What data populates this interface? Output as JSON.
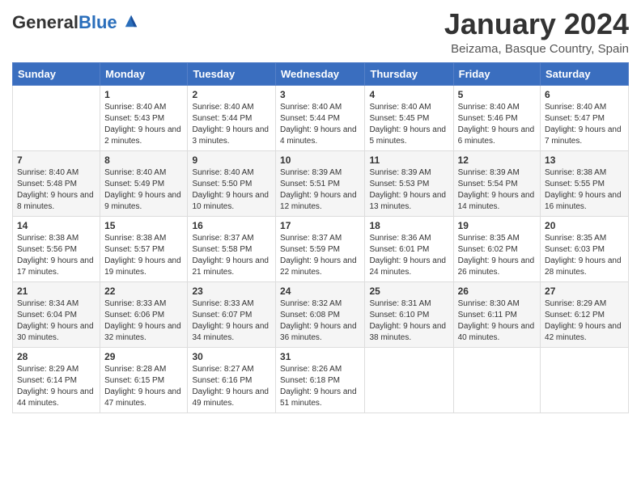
{
  "header": {
    "logo_general": "General",
    "logo_blue": "Blue",
    "month": "January 2024",
    "location": "Beizama, Basque Country, Spain"
  },
  "weekdays": [
    "Sunday",
    "Monday",
    "Tuesday",
    "Wednesday",
    "Thursday",
    "Friday",
    "Saturday"
  ],
  "weeks": [
    [
      {
        "num": "",
        "sunrise": "",
        "sunset": "",
        "daylight": ""
      },
      {
        "num": "1",
        "sunrise": "Sunrise: 8:40 AM",
        "sunset": "Sunset: 5:43 PM",
        "daylight": "Daylight: 9 hours and 2 minutes."
      },
      {
        "num": "2",
        "sunrise": "Sunrise: 8:40 AM",
        "sunset": "Sunset: 5:44 PM",
        "daylight": "Daylight: 9 hours and 3 minutes."
      },
      {
        "num": "3",
        "sunrise": "Sunrise: 8:40 AM",
        "sunset": "Sunset: 5:44 PM",
        "daylight": "Daylight: 9 hours and 4 minutes."
      },
      {
        "num": "4",
        "sunrise": "Sunrise: 8:40 AM",
        "sunset": "Sunset: 5:45 PM",
        "daylight": "Daylight: 9 hours and 5 minutes."
      },
      {
        "num": "5",
        "sunrise": "Sunrise: 8:40 AM",
        "sunset": "Sunset: 5:46 PM",
        "daylight": "Daylight: 9 hours and 6 minutes."
      },
      {
        "num": "6",
        "sunrise": "Sunrise: 8:40 AM",
        "sunset": "Sunset: 5:47 PM",
        "daylight": "Daylight: 9 hours and 7 minutes."
      }
    ],
    [
      {
        "num": "7",
        "sunrise": "Sunrise: 8:40 AM",
        "sunset": "Sunset: 5:48 PM",
        "daylight": "Daylight: 9 hours and 8 minutes."
      },
      {
        "num": "8",
        "sunrise": "Sunrise: 8:40 AM",
        "sunset": "Sunset: 5:49 PM",
        "daylight": "Daylight: 9 hours and 9 minutes."
      },
      {
        "num": "9",
        "sunrise": "Sunrise: 8:40 AM",
        "sunset": "Sunset: 5:50 PM",
        "daylight": "Daylight: 9 hours and 10 minutes."
      },
      {
        "num": "10",
        "sunrise": "Sunrise: 8:39 AM",
        "sunset": "Sunset: 5:51 PM",
        "daylight": "Daylight: 9 hours and 12 minutes."
      },
      {
        "num": "11",
        "sunrise": "Sunrise: 8:39 AM",
        "sunset": "Sunset: 5:53 PM",
        "daylight": "Daylight: 9 hours and 13 minutes."
      },
      {
        "num": "12",
        "sunrise": "Sunrise: 8:39 AM",
        "sunset": "Sunset: 5:54 PM",
        "daylight": "Daylight: 9 hours and 14 minutes."
      },
      {
        "num": "13",
        "sunrise": "Sunrise: 8:38 AM",
        "sunset": "Sunset: 5:55 PM",
        "daylight": "Daylight: 9 hours and 16 minutes."
      }
    ],
    [
      {
        "num": "14",
        "sunrise": "Sunrise: 8:38 AM",
        "sunset": "Sunset: 5:56 PM",
        "daylight": "Daylight: 9 hours and 17 minutes."
      },
      {
        "num": "15",
        "sunrise": "Sunrise: 8:38 AM",
        "sunset": "Sunset: 5:57 PM",
        "daylight": "Daylight: 9 hours and 19 minutes."
      },
      {
        "num": "16",
        "sunrise": "Sunrise: 8:37 AM",
        "sunset": "Sunset: 5:58 PM",
        "daylight": "Daylight: 9 hours and 21 minutes."
      },
      {
        "num": "17",
        "sunrise": "Sunrise: 8:37 AM",
        "sunset": "Sunset: 5:59 PM",
        "daylight": "Daylight: 9 hours and 22 minutes."
      },
      {
        "num": "18",
        "sunrise": "Sunrise: 8:36 AM",
        "sunset": "Sunset: 6:01 PM",
        "daylight": "Daylight: 9 hours and 24 minutes."
      },
      {
        "num": "19",
        "sunrise": "Sunrise: 8:35 AM",
        "sunset": "Sunset: 6:02 PM",
        "daylight": "Daylight: 9 hours and 26 minutes."
      },
      {
        "num": "20",
        "sunrise": "Sunrise: 8:35 AM",
        "sunset": "Sunset: 6:03 PM",
        "daylight": "Daylight: 9 hours and 28 minutes."
      }
    ],
    [
      {
        "num": "21",
        "sunrise": "Sunrise: 8:34 AM",
        "sunset": "Sunset: 6:04 PM",
        "daylight": "Daylight: 9 hours and 30 minutes."
      },
      {
        "num": "22",
        "sunrise": "Sunrise: 8:33 AM",
        "sunset": "Sunset: 6:06 PM",
        "daylight": "Daylight: 9 hours and 32 minutes."
      },
      {
        "num": "23",
        "sunrise": "Sunrise: 8:33 AM",
        "sunset": "Sunset: 6:07 PM",
        "daylight": "Daylight: 9 hours and 34 minutes."
      },
      {
        "num": "24",
        "sunrise": "Sunrise: 8:32 AM",
        "sunset": "Sunset: 6:08 PM",
        "daylight": "Daylight: 9 hours and 36 minutes."
      },
      {
        "num": "25",
        "sunrise": "Sunrise: 8:31 AM",
        "sunset": "Sunset: 6:10 PM",
        "daylight": "Daylight: 9 hours and 38 minutes."
      },
      {
        "num": "26",
        "sunrise": "Sunrise: 8:30 AM",
        "sunset": "Sunset: 6:11 PM",
        "daylight": "Daylight: 9 hours and 40 minutes."
      },
      {
        "num": "27",
        "sunrise": "Sunrise: 8:29 AM",
        "sunset": "Sunset: 6:12 PM",
        "daylight": "Daylight: 9 hours and 42 minutes."
      }
    ],
    [
      {
        "num": "28",
        "sunrise": "Sunrise: 8:29 AM",
        "sunset": "Sunset: 6:14 PM",
        "daylight": "Daylight: 9 hours and 44 minutes."
      },
      {
        "num": "29",
        "sunrise": "Sunrise: 8:28 AM",
        "sunset": "Sunset: 6:15 PM",
        "daylight": "Daylight: 9 hours and 47 minutes."
      },
      {
        "num": "30",
        "sunrise": "Sunrise: 8:27 AM",
        "sunset": "Sunset: 6:16 PM",
        "daylight": "Daylight: 9 hours and 49 minutes."
      },
      {
        "num": "31",
        "sunrise": "Sunrise: 8:26 AM",
        "sunset": "Sunset: 6:18 PM",
        "daylight": "Daylight: 9 hours and 51 minutes."
      },
      {
        "num": "",
        "sunrise": "",
        "sunset": "",
        "daylight": ""
      },
      {
        "num": "",
        "sunrise": "",
        "sunset": "",
        "daylight": ""
      },
      {
        "num": "",
        "sunrise": "",
        "sunset": "",
        "daylight": ""
      }
    ]
  ]
}
